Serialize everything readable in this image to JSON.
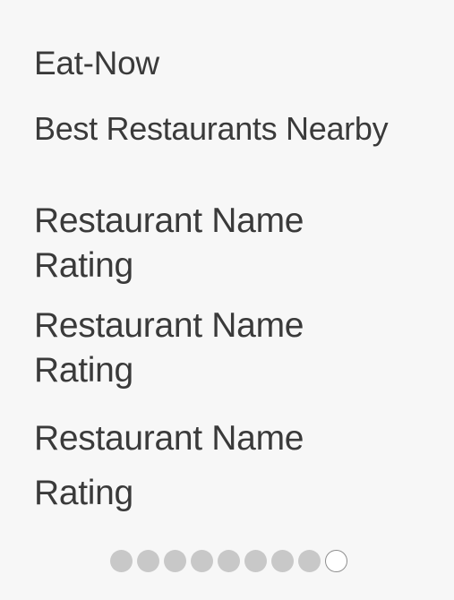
{
  "header": {
    "title": "Eat-Now",
    "subtitle": "Best Restaurants Nearby"
  },
  "restaurants": [
    {
      "name": "Restaurant Name",
      "rating": "Rating"
    },
    {
      "name": "Restaurant Name",
      "rating": "Rating"
    },
    {
      "name": "Restaurant Name",
      "rating": "Rating"
    }
  ],
  "pagination": {
    "page_count": 9,
    "current_page": 9
  },
  "colors": {
    "background": "#f7f7f7",
    "text": "#3a3a3a",
    "dot_inactive": "#c8c8c8",
    "dot_active": "#ffffff"
  }
}
